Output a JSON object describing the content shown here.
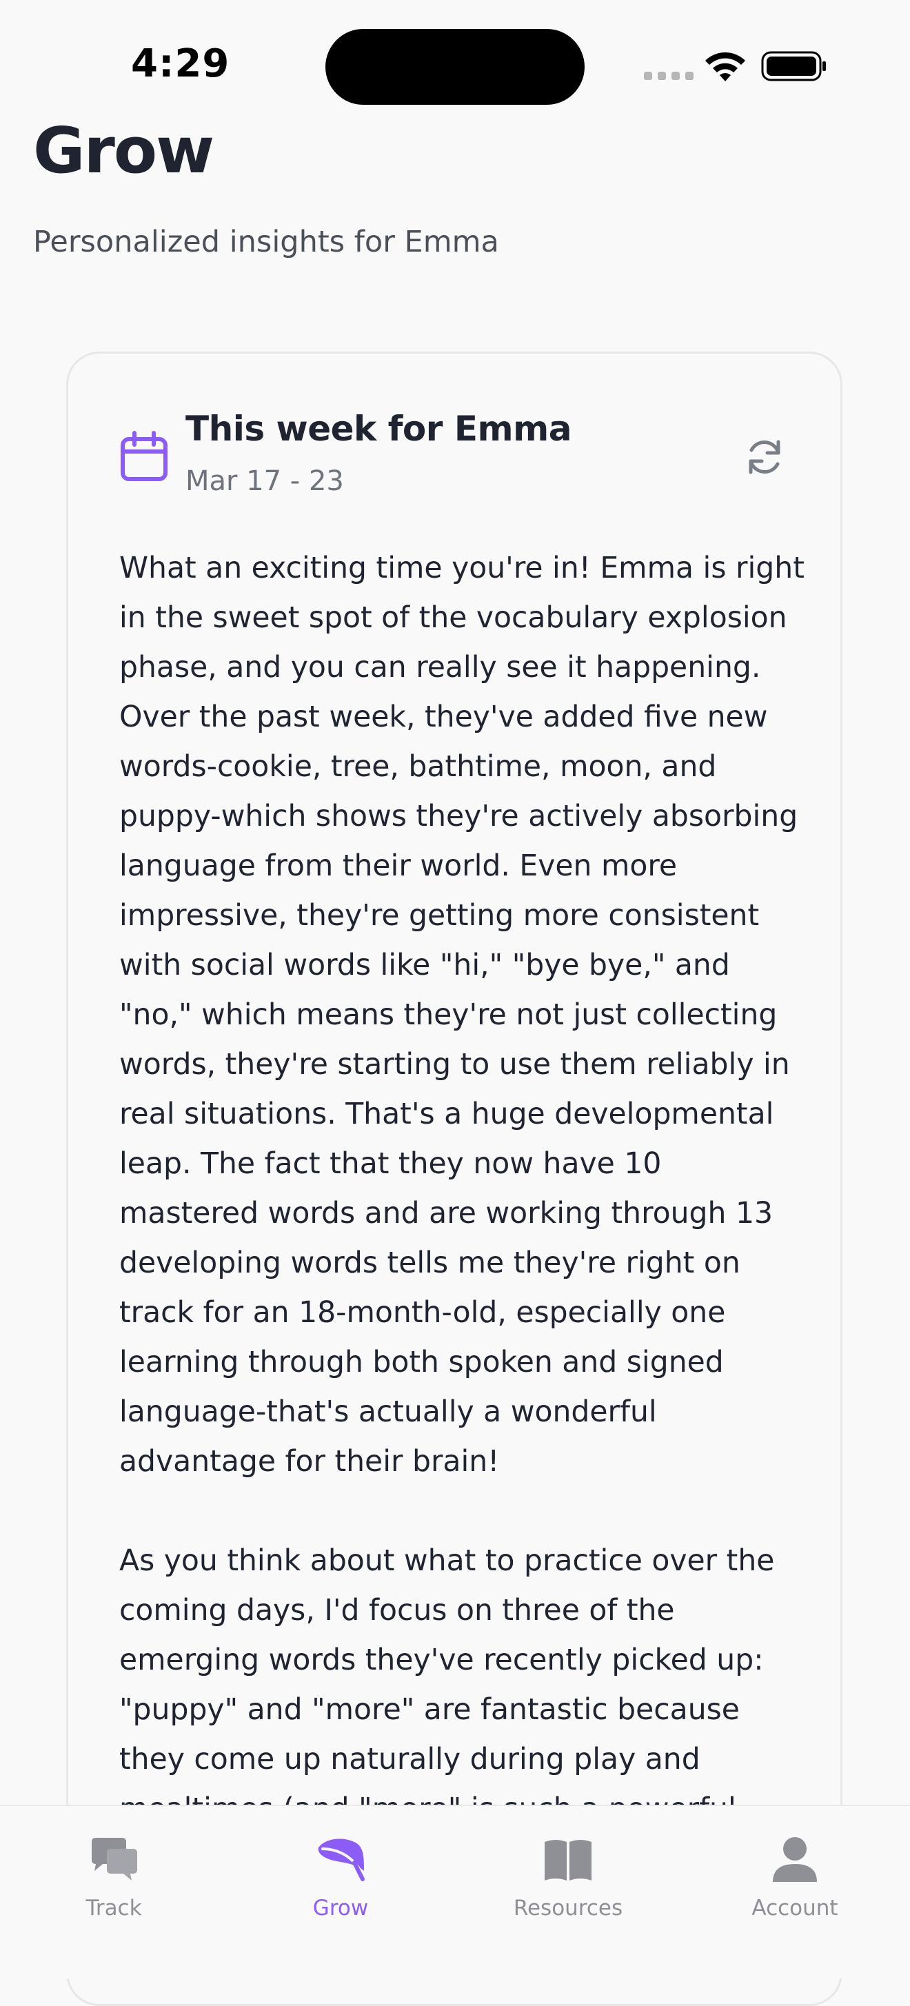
{
  "status_bar": {
    "time": "4:29"
  },
  "header": {
    "title": "Grow",
    "subtitle": "Personalized insights for Emma"
  },
  "card": {
    "title": "This week for Emma",
    "date_range": "Mar 17 - 23",
    "icon": "calendar-icon",
    "action_icon": "refresh-icon",
    "accent_color": "#8B5CF6",
    "paragraphs": [
      "What an exciting time you're in! Emma is right in the sweet spot of the vocabulary explosion phase, and you can really see it happening. Over the past week, they've added five new words-cookie, tree, bathtime, moon, and puppy-which shows they're actively absorbing language from their world. Even more impressive, they're getting more consistent with social words like \"hi,\" \"bye bye,\" and \"no,\" which means they're not just collecting words, they're starting to use them reliably in real situations. That's a huge developmental leap. The fact that they now have 10 mastered words and are working through 13 developing words tells me they're right on track for an 18-month-old, especially one learning through both spoken and signed language-that's actually a wonderful advantage for their brain!",
      "As you think about what to practice over the coming days, I'd focus on three of the emerging words they've recently picked up: \"puppy\" and \"more\" are fantastic because they come up naturally during play and mealtimes (and \"more\" is such a powerful"
    ]
  },
  "tab_bar": {
    "active_color": "#8B5CF6",
    "inactive_color": "#8E9096",
    "tabs": [
      {
        "label": "Track",
        "icon": "chat-bubbles-icon",
        "active": false
      },
      {
        "label": "Grow",
        "icon": "leaf-icon",
        "active": true
      },
      {
        "label": "Resources",
        "icon": "book-icon",
        "active": false
      },
      {
        "label": "Account",
        "icon": "person-icon",
        "active": false
      }
    ]
  }
}
